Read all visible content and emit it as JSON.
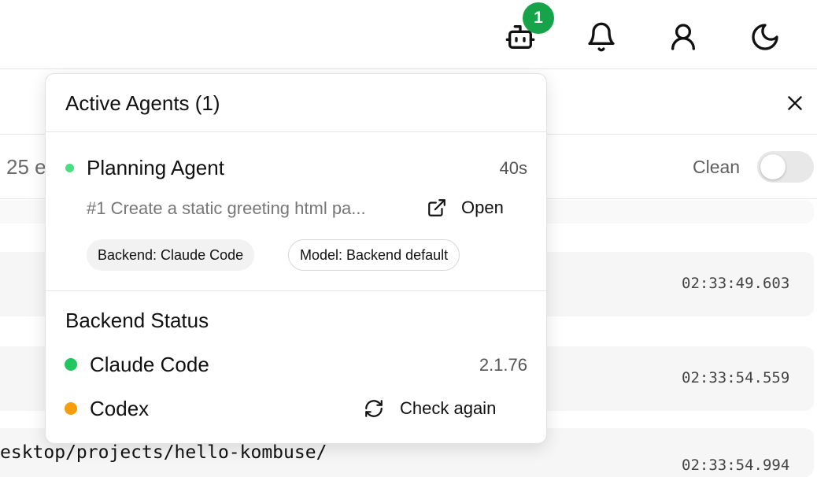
{
  "header": {
    "agents_badge_count": "1",
    "icons": [
      "robot-icon",
      "bell-icon",
      "user-icon",
      "moon-icon"
    ]
  },
  "background": {
    "count_text": "25 e",
    "clean_label": "Clean",
    "clean_toggle_on": false,
    "log_rows": [
      {
        "time": "02:33:49.603"
      },
      {
        "time": "02:33:54.559"
      },
      {
        "time": "02:33:54.994",
        "text": "esktop/projects/hello-kombuse/"
      }
    ]
  },
  "popover": {
    "title": "Active Agents (1)",
    "agents": [
      {
        "name": "Planning Agent",
        "elapsed": "40s",
        "status_color": "#4ade80",
        "task": "#1 Create a static greeting html pa...",
        "open_label": "Open",
        "backend_pill": "Backend: Claude Code",
        "model_pill": "Model: Backend default"
      }
    ],
    "backend_status": {
      "title": "Backend Status",
      "items": [
        {
          "name": "Claude Code",
          "version": "2.1.76",
          "status_color": "#22c55e"
        },
        {
          "name": "Codex",
          "action_label": "Check again",
          "status_color": "#f59e0b"
        }
      ]
    }
  }
}
